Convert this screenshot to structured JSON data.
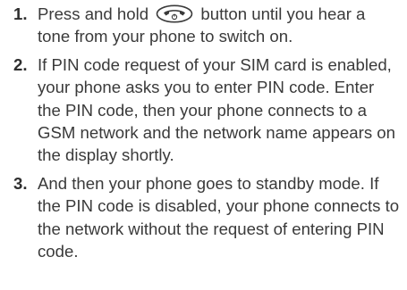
{
  "steps": [
    {
      "number": "1.",
      "text_before_icon": "Press and hold",
      "icon": "power-end-key-icon",
      "text_after_icon": "button until you hear a tone from your phone to switch on."
    },
    {
      "number": "2.",
      "text": "If PIN code request of your SIM card is enabled, your phone asks you to enter PIN code. Enter the PIN code, then your phone connects to a GSM network and the network name appears on the display shortly."
    },
    {
      "number": "3.",
      "text": "And then your phone goes to standby mode. If the PIN code is disabled, your phone connects to the network without the request of entering PIN code."
    }
  ]
}
